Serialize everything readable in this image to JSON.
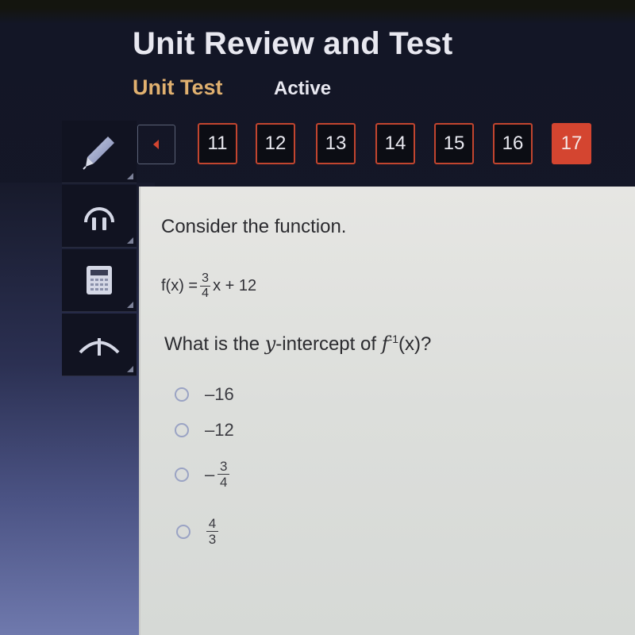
{
  "header": {
    "title": "Unit Review and Test",
    "subtitle": "Unit Test",
    "status": "Active"
  },
  "toolbar": {
    "tools": [
      {
        "name": "pencil-icon",
        "label": "Pencil"
      },
      {
        "name": "headphones-icon",
        "label": "Audio"
      },
      {
        "name": "calculator-icon",
        "label": "Calculator"
      },
      {
        "name": "reference-icon",
        "label": "Reference"
      }
    ]
  },
  "navigation": {
    "prev_icon": "triangle-left",
    "questions": [
      "11",
      "12",
      "13",
      "14",
      "15",
      "16",
      "17"
    ],
    "active_question": "17",
    "accent_color": "#d44530"
  },
  "question": {
    "prompt": "Consider the function.",
    "equation": {
      "lhs": "f(x) =",
      "frac_num": "3",
      "frac_den": "4",
      "rhs": "x + 12"
    },
    "text_before": "What is the ",
    "text_italic": "y",
    "text_mid": "-intercept of ",
    "func": "f",
    "sup": "-1",
    "text_after": "(x)?",
    "options": [
      {
        "label": "–16",
        "selected": false
      },
      {
        "label": "–12",
        "selected": false
      },
      {
        "sign": "–",
        "num": "3",
        "den": "4",
        "selected": false
      },
      {
        "sign": "",
        "num": "4",
        "den": "3",
        "selected": false
      }
    ]
  }
}
